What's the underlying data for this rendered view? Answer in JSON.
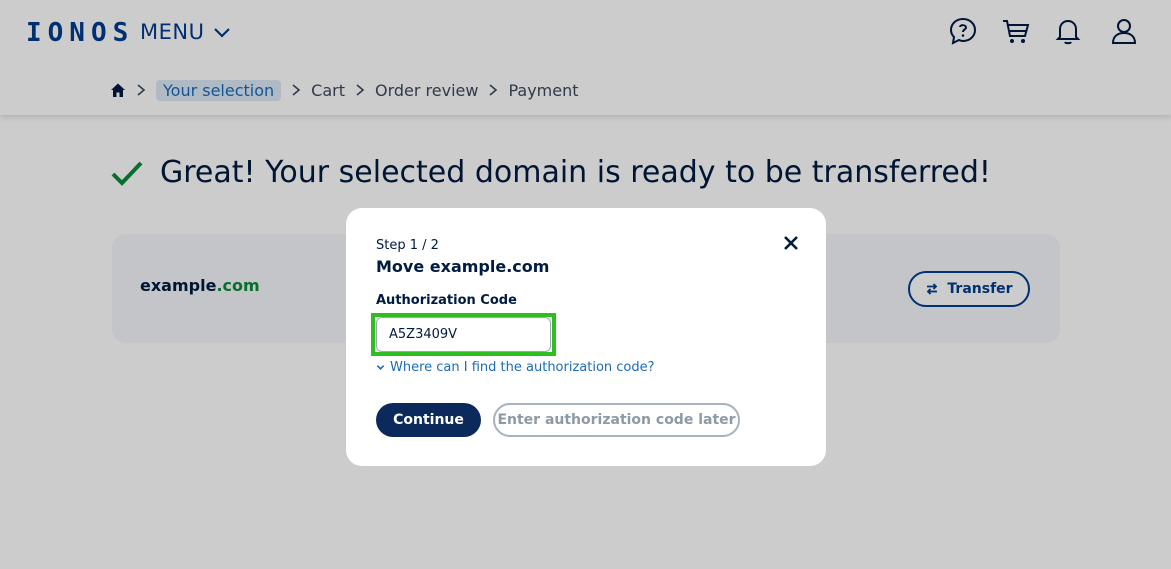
{
  "header": {
    "logo": "IONOS",
    "menu_label": "MENU",
    "icons": [
      "help-chat-icon",
      "cart-icon",
      "bell-icon",
      "user-icon"
    ]
  },
  "breadcrumb": {
    "items": [
      {
        "label": "Your selection",
        "active": true
      },
      {
        "label": "Cart",
        "active": false
      },
      {
        "label": "Order review",
        "active": false
      },
      {
        "label": "Payment",
        "active": false
      }
    ]
  },
  "main": {
    "headline": "Great! Your selected domain is ready to be transferred!",
    "domain_name": "example",
    "domain_tld": ".com",
    "transfer_label": "Transfer"
  },
  "modal": {
    "step": "Step 1 / 2",
    "title": "Move example.com",
    "field_label": "Authorization Code",
    "field_value": "A5Z3409V",
    "help_link": "Where can I find the authorization code?",
    "continue_label": "Continue",
    "later_label": "Enter authorization code later"
  },
  "colors": {
    "brand": "#003d8f",
    "primary_button": "#0b2a5b",
    "success": "#0b8a3a",
    "highlight": "#2dbe1f",
    "link": "#1b6bb8"
  }
}
